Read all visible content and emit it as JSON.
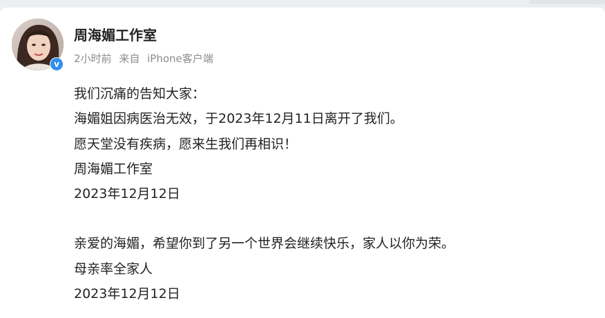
{
  "post": {
    "author": "周海媚工作室",
    "time": "2小时前",
    "source_prefix": "来自",
    "source_client": "iPhone客户端",
    "verified_mark": "v",
    "paragraphs": [
      [
        "我们沉痛的告知大家：",
        "海媚姐因病医治无效，于2023年12月11日离开了我们。",
        "愿天堂没有疾病，愿来生我们再相识！",
        "周海媚工作室",
        "2023年12月12日"
      ],
      [
        "亲爱的海媚，希望你到了另一个世界会继续快乐，家人以你为荣。",
        "母亲率全家人",
        "2023年12月12日"
      ]
    ]
  },
  "colors": {
    "verified_badge": "#2f8ff0",
    "meta_text": "#8b8b8b",
    "body_text": "#222222"
  }
}
